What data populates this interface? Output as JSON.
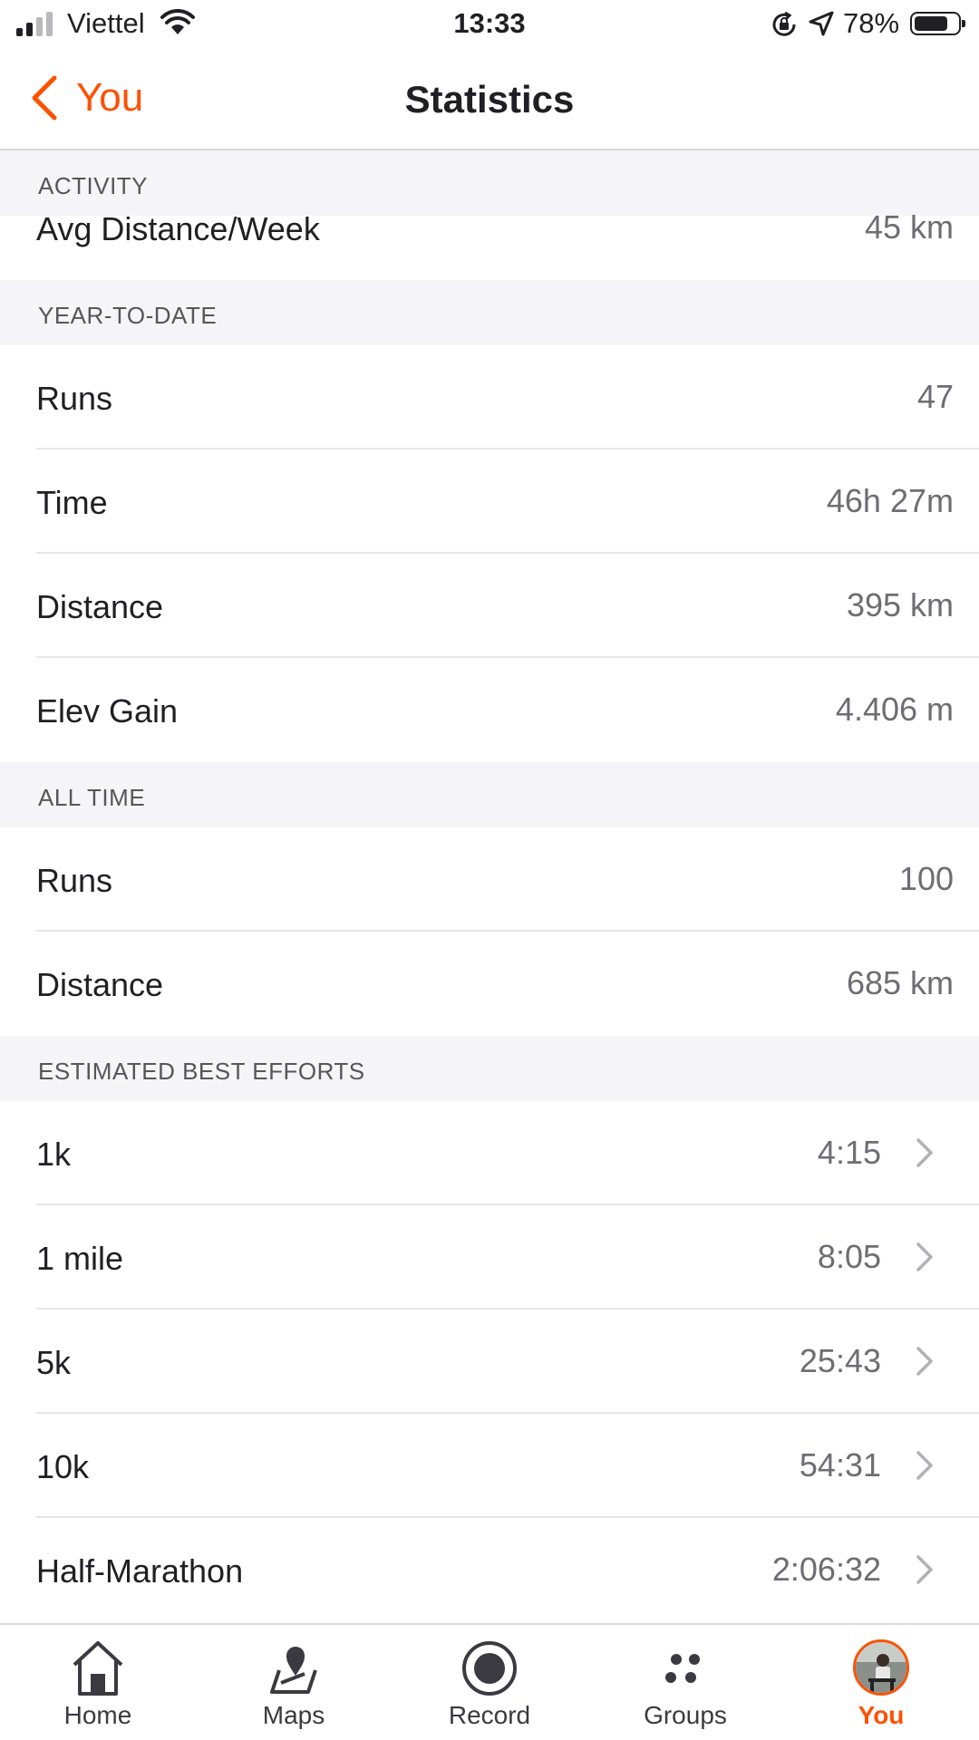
{
  "status_bar": {
    "carrier": "Viettel",
    "time": "13:33",
    "battery_percent": "78%",
    "battery_level": 0.78
  },
  "nav": {
    "back_label": "You",
    "title": "Statistics"
  },
  "sections": {
    "activity": {
      "header": "ACTIVITY",
      "avg_label": "Avg Distance/Week",
      "avg_value": "45 km"
    },
    "ytd": {
      "header": "YEAR-TO-DATE",
      "rows": [
        {
          "label": "Runs",
          "value": "47"
        },
        {
          "label": "Time",
          "value": "46h 27m"
        },
        {
          "label": "Distance",
          "value": "395 km"
        },
        {
          "label": "Elev Gain",
          "value": "4.406 m"
        }
      ]
    },
    "all_time": {
      "header": "ALL TIME",
      "rows": [
        {
          "label": "Runs",
          "value": "100"
        },
        {
          "label": "Distance",
          "value": "685 km"
        }
      ]
    },
    "best_efforts": {
      "header": "ESTIMATED BEST EFFORTS",
      "rows": [
        {
          "label": "1k",
          "value": "4:15"
        },
        {
          "label": "1 mile",
          "value": "8:05"
        },
        {
          "label": "5k",
          "value": "25:43"
        },
        {
          "label": "10k",
          "value": "54:31"
        },
        {
          "label": "Half-Marathon",
          "value": "2:06:32"
        }
      ]
    }
  },
  "tabs": [
    {
      "label": "Home",
      "icon": "home-icon"
    },
    {
      "label": "Maps",
      "icon": "maps-icon"
    },
    {
      "label": "Record",
      "icon": "record-icon"
    },
    {
      "label": "Groups",
      "icon": "groups-icon"
    },
    {
      "label": "You",
      "icon": "avatar",
      "active": true
    }
  ],
  "colors": {
    "accent": "#fc5200",
    "section_bg": "#f5f5f7",
    "value_text": "#6d6d73"
  }
}
